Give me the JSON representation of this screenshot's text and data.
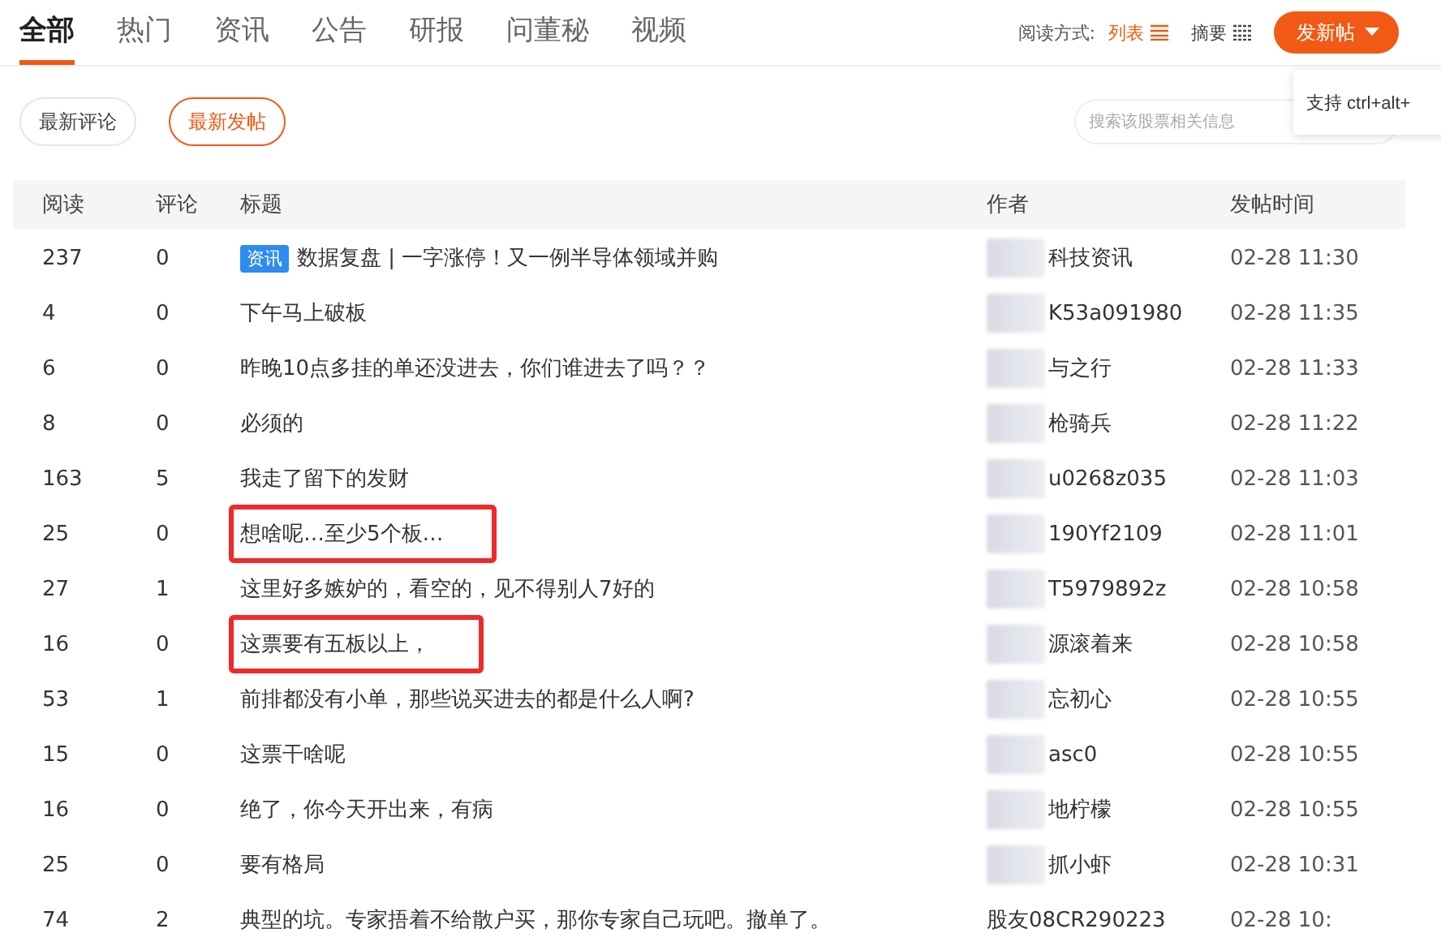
{
  "tabs": [
    {
      "label": "全部",
      "selected": true
    },
    {
      "label": "热门",
      "selected": false
    },
    {
      "label": "资讯",
      "selected": false
    },
    {
      "label": "公告",
      "selected": false
    },
    {
      "label": "研报",
      "selected": false
    },
    {
      "label": "问董秘",
      "selected": false
    },
    {
      "label": "视频",
      "selected": false
    }
  ],
  "view_mode": {
    "label": "阅读方式:",
    "options": [
      {
        "label": "列表",
        "selected": true
      },
      {
        "label": "摘要",
        "selected": false
      }
    ]
  },
  "post_button": {
    "label": "发新帖"
  },
  "tooltip": {
    "text": "支持 ctrl+alt+"
  },
  "filters": [
    {
      "label": "最新评论",
      "selected": false
    },
    {
      "label": "最新发帖",
      "selected": true
    }
  ],
  "search": {
    "placeholder": "搜索该股票相关信息"
  },
  "table": {
    "columns": [
      "阅读",
      "评论",
      "标题",
      "作者",
      "发帖时间"
    ],
    "rows": [
      {
        "reads": "237",
        "comments": "0",
        "tag": "资讯",
        "title": "数据复盘 | 一字涨停！又一例半导体领域并购",
        "author": "科技资讯",
        "author_blurred": true,
        "time": "02-28 11:30",
        "highlighted": false
      },
      {
        "reads": "4",
        "comments": "0",
        "title": "下午马上破板",
        "author": "K53a091980",
        "author_blurred": true,
        "time": "02-28 11:35",
        "highlighted": false
      },
      {
        "reads": "6",
        "comments": "0",
        "title": "昨晚10点多挂的单还没进去，你们谁进去了吗？？",
        "author": "与之行",
        "author_blurred": true,
        "time": "02-28 11:33",
        "highlighted": false
      },
      {
        "reads": "8",
        "comments": "0",
        "title": "必须的",
        "author": "枪骑兵",
        "author_blurred": true,
        "time": "02-28 11:22",
        "highlighted": false
      },
      {
        "reads": "163",
        "comments": "5",
        "title": "我走了留下的发财",
        "author": "u0268z035",
        "author_blurred": true,
        "time": "02-28 11:03",
        "highlighted": false
      },
      {
        "reads": "25",
        "comments": "0",
        "title": "想啥呢…至少5个板…",
        "author": "190Yf2109",
        "author_blurred": true,
        "time": "02-28 11:01",
        "highlighted": true
      },
      {
        "reads": "27",
        "comments": "1",
        "title": "这里好多嫉妒的，看空的，见不得别人7好的",
        "author": "T5979892z",
        "author_blurred": true,
        "time": "02-28 10:58",
        "highlighted": false
      },
      {
        "reads": "16",
        "comments": "0",
        "title": "这票要有五板以上，",
        "author": "源滚着来",
        "author_blurred": true,
        "time": "02-28 10:58",
        "highlighted": true
      },
      {
        "reads": "53",
        "comments": "1",
        "title": "前排都没有小单，那些说买进去的都是什么人啊?",
        "author": "忘初心",
        "author_blurred": true,
        "time": "02-28 10:55",
        "highlighted": false
      },
      {
        "reads": "15",
        "comments": "0",
        "title": "这票干啥呢",
        "author": "asc0",
        "author_blurred": true,
        "time": "02-28 10:55",
        "highlighted": false
      },
      {
        "reads": "16",
        "comments": "0",
        "title": "绝了，你今天开出来，有病",
        "author": "地柠檬",
        "author_blurred": true,
        "time": "02-28 10:55",
        "highlighted": false
      },
      {
        "reads": "25",
        "comments": "0",
        "title": "要有格局",
        "author": "抓小虾",
        "author_blurred": true,
        "time": "02-28 10:31",
        "highlighted": false
      },
      {
        "reads": "74",
        "comments": "2",
        "title": "典型的坑。专家捂着不给散户买，那你专家自己玩吧。撤单了。",
        "author": "股友08CR290223",
        "author_blurred": false,
        "time": "02-28 10:",
        "highlighted": false
      }
    ]
  }
}
